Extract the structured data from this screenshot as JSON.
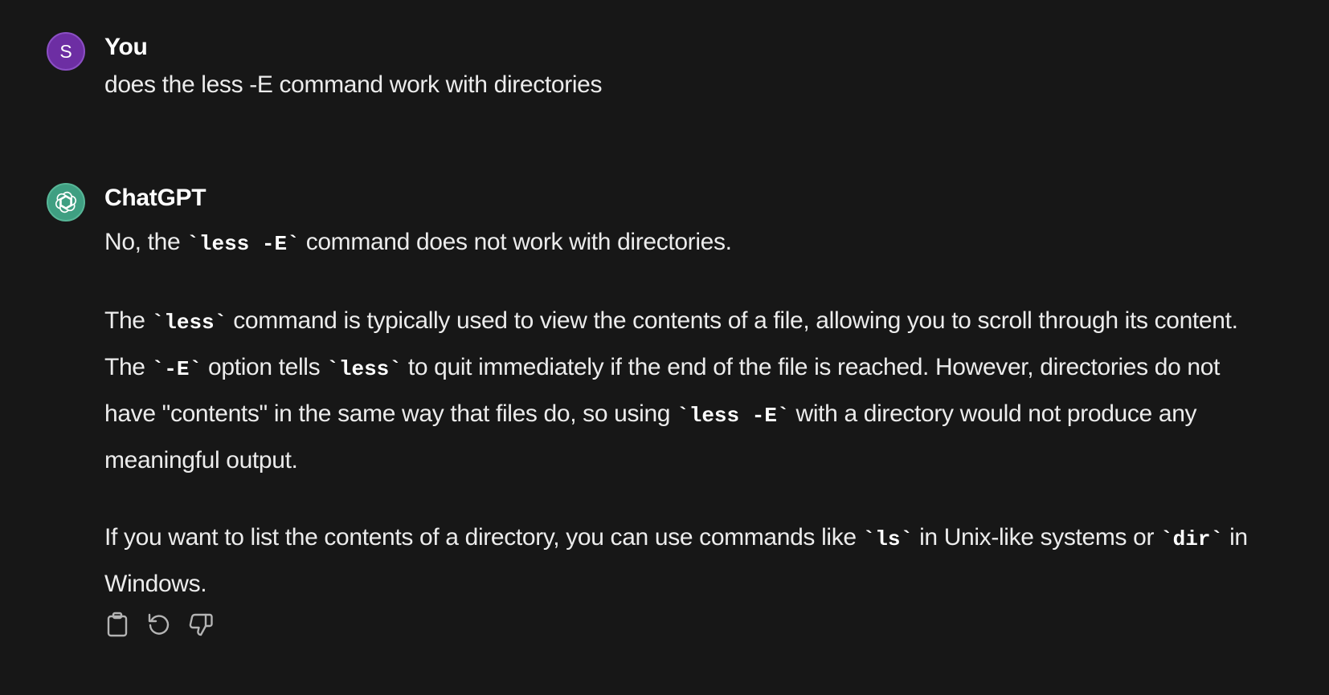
{
  "user_message": {
    "avatar_initial": "S",
    "sender": "You",
    "text": "does the less -E command work with directories"
  },
  "assistant_message": {
    "sender": "ChatGPT",
    "avatar_icon": "openai-logo-icon",
    "paragraphs": [
      {
        "segments": [
          {
            "type": "text",
            "value": "No, the "
          },
          {
            "type": "code",
            "value": "`less -E`"
          },
          {
            "type": "text",
            "value": " command does not work with directories."
          }
        ]
      },
      {
        "segments": [
          {
            "type": "text",
            "value": "The "
          },
          {
            "type": "code",
            "value": "`less`"
          },
          {
            "type": "text",
            "value": " command is typically used to view the contents of a file, allowing you to scroll through its content. The "
          },
          {
            "type": "code",
            "value": "`-E`"
          },
          {
            "type": "text",
            "value": " option tells "
          },
          {
            "type": "code",
            "value": "`less`"
          },
          {
            "type": "text",
            "value": " to quit immediately if the end of the file is reached. However, directories do not have \"contents\" in the same way that files do, so using "
          },
          {
            "type": "code",
            "value": "`less -E`"
          },
          {
            "type": "text",
            "value": " with a directory would not produce any meaningful output."
          }
        ]
      },
      {
        "segments": [
          {
            "type": "text",
            "value": "If you want to list the contents of a directory, you can use commands like "
          },
          {
            "type": "code",
            "value": "`ls`"
          },
          {
            "type": "text",
            "value": " in Unix-like systems or "
          },
          {
            "type": "code",
            "value": "`dir`"
          },
          {
            "type": "text",
            "value": " in Windows."
          }
        ]
      }
    ],
    "actions": [
      {
        "name": "copy-button",
        "icon": "clipboard-icon"
      },
      {
        "name": "regenerate-button",
        "icon": "refresh-icon"
      },
      {
        "name": "thumbs-down-button",
        "icon": "thumbs-down-icon"
      }
    ]
  },
  "colors": {
    "background": "#171717",
    "text": "#ececec",
    "user_avatar": "#6d2ea3",
    "assistant_avatar": "#3f9f82",
    "icon": "#b4b4b4"
  }
}
